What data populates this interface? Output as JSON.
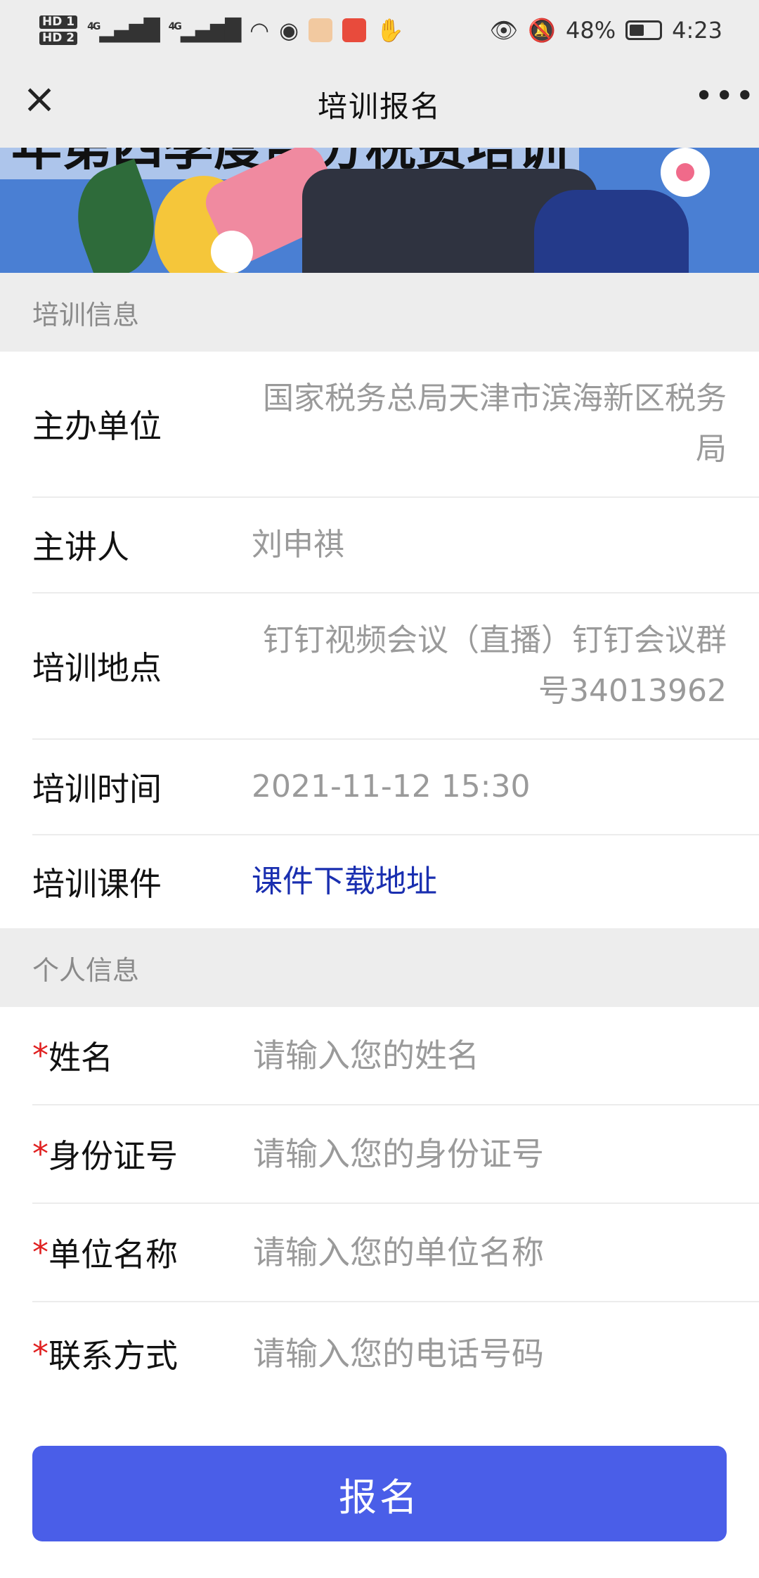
{
  "status_bar": {
    "hd1": "HD 1",
    "hd2": "HD 2",
    "net1": "4G",
    "net2": "4G",
    "battery_percent": "48%",
    "time": "4:23"
  },
  "nav": {
    "title": "培训报名",
    "close_icon": "close-icon",
    "more_icon": "more-icon"
  },
  "banner": {
    "text": "年第四季度部分税费培训"
  },
  "training_section": {
    "header": "培训信息",
    "rows": [
      {
        "label": "主办单位",
        "value": "国家税务总局天津市滨海新区税务局"
      },
      {
        "label": "主讲人",
        "value": "刘申祺"
      },
      {
        "label": "培训地点",
        "value": "钉钉视频会议（直播）钉钉会议群号34013962"
      },
      {
        "label": "培训时间",
        "value": "2021-11-12 15:30"
      },
      {
        "label": "培训课件",
        "value": "课件下载地址"
      }
    ]
  },
  "personal_section": {
    "header": "个人信息",
    "required_mark": "*",
    "fields": [
      {
        "label": "姓名",
        "placeholder": "请输入您的姓名",
        "value": ""
      },
      {
        "label": "身份证号",
        "placeholder": "请输入您的身份证号",
        "value": ""
      },
      {
        "label": "单位名称",
        "placeholder": "请输入您的单位名称",
        "value": ""
      },
      {
        "label": "联系方式",
        "placeholder": "请输入您的电话号码",
        "value": ""
      }
    ]
  },
  "submit_label": "报名",
  "colors": {
    "accent": "#4a5ee8",
    "link": "#1a2fb0",
    "required": "#e02020",
    "placeholder": "#9a9a9a"
  }
}
